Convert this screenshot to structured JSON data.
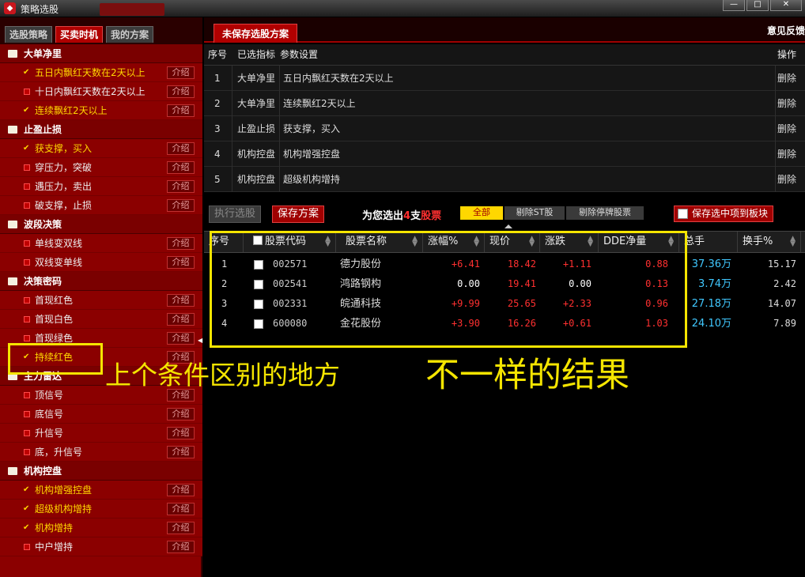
{
  "window": {
    "title": "策略选股",
    "buttons": [
      "—",
      "□",
      "✕"
    ]
  },
  "left_tabs": [
    "选股策略",
    "买卖时机",
    "我的方案"
  ],
  "intro_label": "介绍",
  "tree": [
    {
      "group": "大单净里",
      "items": [
        {
          "label": "五日内飘红天数在2天以上",
          "checked": true
        },
        {
          "label": "十日内飘红天数在2天以上",
          "checked": false
        },
        {
          "label": "连续飘红2天以上",
          "checked": true
        }
      ]
    },
    {
      "group": "止盈止损",
      "items": [
        {
          "label": "获支撑，买入",
          "checked": true
        },
        {
          "label": "穿压力，突破",
          "checked": false
        },
        {
          "label": "遇压力，卖出",
          "checked": false
        },
        {
          "label": "破支撑，止损",
          "checked": false
        }
      ]
    },
    {
      "group": "波段决策",
      "items": [
        {
          "label": "单线变双线",
          "checked": false
        },
        {
          "label": "双线变单线",
          "checked": false
        }
      ]
    },
    {
      "group": "决策密码",
      "items": [
        {
          "label": "首现红色",
          "checked": false
        },
        {
          "label": "首现白色",
          "checked": false
        },
        {
          "label": "首现绿色",
          "checked": false
        },
        {
          "label": "持续红色",
          "checked": true
        }
      ]
    },
    {
      "group": "主力雷达",
      "items": [
        {
          "label": "顶信号",
          "checked": false
        },
        {
          "label": "底信号",
          "checked": false
        },
        {
          "label": "升信号",
          "checked": false
        },
        {
          "label": "底，升信号",
          "checked": false
        }
      ]
    },
    {
      "group": "机构控盘",
      "items": [
        {
          "label": "机构增强控盘",
          "checked": true
        },
        {
          "label": "超级机构增持",
          "checked": true
        },
        {
          "label": "机构增持",
          "checked": true
        },
        {
          "label": "中户增持",
          "checked": false
        }
      ]
    }
  ],
  "right_tab": "未保存选股方案",
  "feedback": "意见反馈",
  "params_header": {
    "seq": "序号",
    "indicator": "已选指标",
    "param": "参数设置",
    "op": "操作"
  },
  "params": [
    {
      "seq": "1",
      "indicator": "大单净里",
      "param": "五日内飘红天数在2天以上",
      "op": "删除"
    },
    {
      "seq": "2",
      "indicator": "大单净里",
      "param": "连续飘红2天以上",
      "op": "删除"
    },
    {
      "seq": "3",
      "indicator": "止盈止损",
      "param": "获支撑，买入",
      "op": "删除"
    },
    {
      "seq": "4",
      "indicator": "机构控盘",
      "param": "机构增强控盘",
      "op": "删除"
    },
    {
      "seq": "5",
      "indicator": "机构控盘",
      "param": "超级机构增持",
      "op": "删除"
    }
  ],
  "toolbar": {
    "run": "执行选股",
    "save": "保存方案",
    "result_pre": "为您选出",
    "result_count": "4",
    "result_mid": "支",
    "result_post": "股票",
    "filter_all": "全部",
    "filter_st": "剔除ST股",
    "filter_halt": "剔除停牌股票",
    "save_block": "保存选中项到板块"
  },
  "results_header": [
    "序号",
    "股票代码",
    "股票名称",
    "涨幅%",
    "现价",
    "涨跌",
    "DDE净量",
    "总手",
    "换手%"
  ],
  "results": [
    {
      "seq": "1",
      "code": "002571",
      "name": "德力股份",
      "pct": "+6.41",
      "price": "18.42",
      "chg": "+1.11",
      "dde": "0.88",
      "vol": "37.36万",
      "turn": "15.17"
    },
    {
      "seq": "2",
      "code": "002541",
      "name": "鸿路钢构",
      "pct": "0.00",
      "price": "19.41",
      "chg": "0.00",
      "dde": "0.13",
      "vol": "3.74万",
      "turn": "2.42"
    },
    {
      "seq": "3",
      "code": "002331",
      "name": "皖通科技",
      "pct": "+9.99",
      "price": "25.65",
      "chg": "+2.33",
      "dde": "0.96",
      "vol": "27.18万",
      "turn": "14.07"
    },
    {
      "seq": "4",
      "code": "600080",
      "name": "金花股份",
      "pct": "+3.90",
      "price": "16.26",
      "chg": "+0.61",
      "dde": "1.03",
      "vol": "24.10万",
      "turn": "7.89"
    }
  ],
  "annotations": {
    "left": "上个条件区别的地方",
    "right": "不一样的结果"
  },
  "colors": {
    "panel_red": "#8b0000",
    "accent_yellow": "#f5e500",
    "up_red": "#ff3030",
    "vol_cyan": "#40c8ff"
  }
}
